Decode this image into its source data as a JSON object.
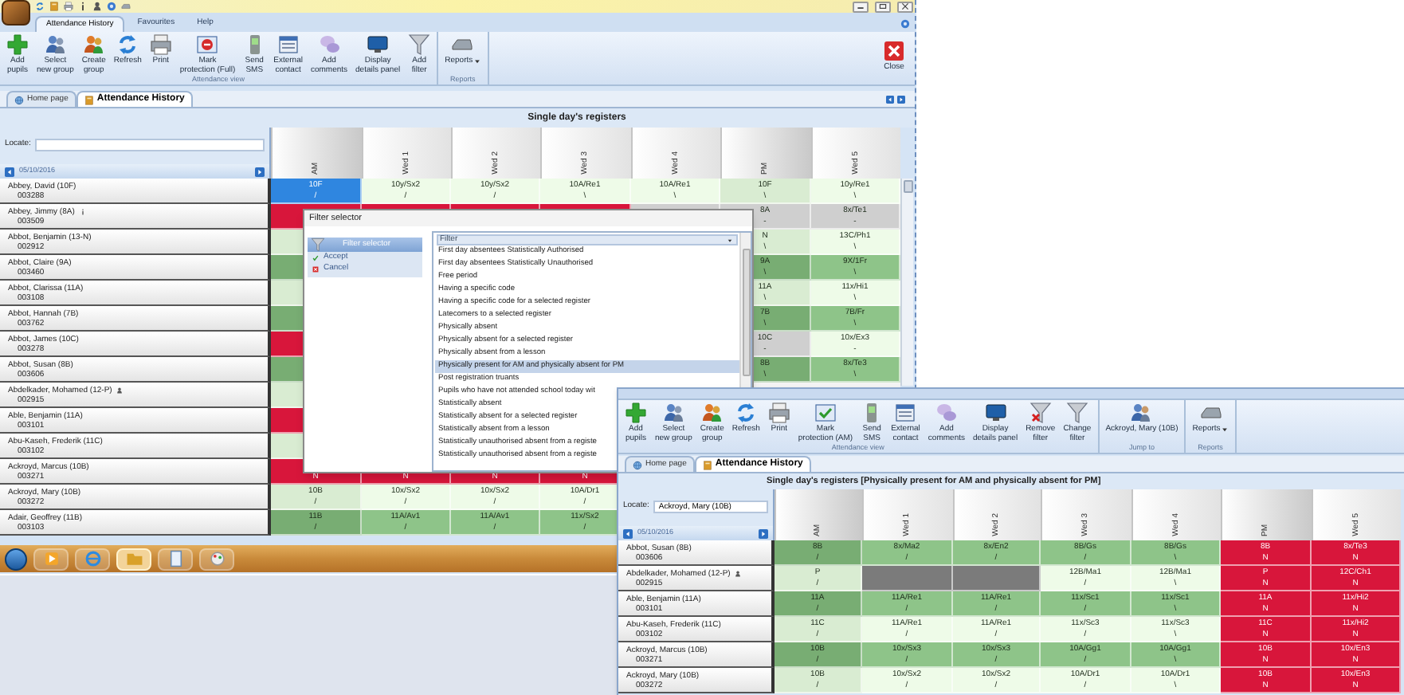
{
  "main_window": {
    "ribbon_tabs": [
      {
        "label": "Attendance History",
        "selected": true
      },
      {
        "label": "Favourites",
        "selected": false
      },
      {
        "label": "Help",
        "selected": false
      }
    ],
    "ribbon_groups": [
      {
        "label": "Attendance view",
        "buttons": [
          {
            "label": "Add\npupils",
            "kind": "add"
          },
          {
            "label": "Select\nnew group",
            "kind": "group"
          },
          {
            "label": "Create\ngroup",
            "kind": "create"
          },
          {
            "label": "Refresh",
            "kind": "refresh"
          },
          {
            "label": "Print",
            "kind": "print"
          },
          {
            "label": "Mark\nprotection (Full)",
            "kind": "protect"
          },
          {
            "label": "Send\nSMS",
            "kind": "sms"
          },
          {
            "label": "External\ncontact",
            "kind": "contact"
          },
          {
            "label": "Add\ncomments",
            "kind": "comment"
          },
          {
            "label": "Display\ndetails panel",
            "kind": "panel"
          },
          {
            "label": "Add\nfilter",
            "kind": "filter"
          }
        ]
      },
      {
        "label": "Reports",
        "buttons": [
          {
            "label": "Reports",
            "kind": "reports"
          }
        ]
      }
    ],
    "close_button": {
      "label": "Close",
      "kind": "close"
    },
    "doc_tabs": [
      {
        "label": "Home page",
        "selected": false
      },
      {
        "label": "Attendance History",
        "selected": true
      }
    ],
    "title": "Single day's registers",
    "locate_label": "Locate:",
    "date": "05/10/2016",
    "columns": [
      "AM",
      "Wed 1",
      "Wed 2",
      "Wed 3",
      "Wed 4",
      "PM",
      "Wed 5"
    ],
    "rows": [
      {
        "name": "Abbey, David (10F)",
        "id": "003288",
        "kind": "plain",
        "cells": [
          {
            "code": "10F",
            "mark": "/",
            "color": "#2f86e0"
          },
          {
            "code": "10y/Sx2",
            "mark": "/",
            "color": "#eefbe8"
          },
          {
            "code": "10y/Sx2",
            "mark": "/",
            "color": "#eefbe8"
          },
          {
            "code": "10A/Re1",
            "mark": "\\",
            "color": "#eefbe8"
          },
          {
            "code": "10A/Re1",
            "mark": "\\",
            "color": "#eefbe8"
          },
          {
            "code": "10F",
            "mark": "\\",
            "color": "#d9ecd2"
          },
          {
            "code": "10y/Re1",
            "mark": "\\",
            "color": "#eefbe8"
          }
        ]
      },
      {
        "name": "Abbey, Jimmy (8A)",
        "id": "003509",
        "kind": "info",
        "cells": [
          {
            "color": "#d8163b"
          },
          {
            "color": "#d8163b"
          },
          {
            "color": "#d8163b"
          },
          {
            "color": "#d8163b"
          },
          {
            "color": "#cfcfcf"
          },
          {
            "code": "8A",
            "mark": "-",
            "color": "#cfcfcf"
          },
          {
            "code": "8x/Te1",
            "mark": "-",
            "color": "#cfcfcf"
          }
        ]
      },
      {
        "name": "Abbot, Benjamin (13-N)",
        "id": "002912",
        "kind": "plain",
        "cells": [
          {
            "color": "#d9ecd2"
          },
          null,
          null,
          null,
          null,
          {
            "code": "N",
            "mark": "\\",
            "color": "#d9ecd2"
          },
          {
            "code": "13C/Ph1",
            "mark": "\\",
            "color": "#eefbe8"
          }
        ]
      },
      {
        "name": "Abbot, Claire (9A)",
        "id": "003460",
        "kind": "plain",
        "cells": [
          {
            "color": "#78ad73"
          },
          null,
          null,
          null,
          null,
          {
            "code": "9A",
            "mark": "\\",
            "color": "#78ad73"
          },
          {
            "code": "9X/1Fr",
            "mark": "\\",
            "color": "#8ec489"
          }
        ]
      },
      {
        "name": "Abbot, Clarissa (11A)",
        "id": "003108",
        "kind": "plain",
        "cells": [
          {
            "color": "#d9ecd2"
          },
          null,
          null,
          null,
          null,
          {
            "code": "11A",
            "mark": "\\",
            "color": "#d9ecd2"
          },
          {
            "code": "11x/Hi1",
            "mark": "\\",
            "color": "#eefbe8"
          }
        ]
      },
      {
        "name": "Abbot, Hannah (7B)",
        "id": "003762",
        "kind": "plain",
        "cells": [
          {
            "color": "#78ad73"
          },
          null,
          null,
          null,
          null,
          {
            "code": "7B",
            "mark": "\\",
            "color": "#78ad73"
          },
          {
            "code": "7B/Fr",
            "mark": "\\",
            "color": "#8ec489"
          }
        ]
      },
      {
        "name": "Abbot, James (10C)",
        "id": "003278",
        "kind": "plain",
        "cells": [
          {
            "color": "#d8163b"
          },
          null,
          null,
          null,
          null,
          {
            "code": "10C",
            "mark": "-",
            "color": "#cfcfcf"
          },
          {
            "code": "10x/Ex3",
            "mark": "-",
            "color": "#eefbe8"
          }
        ]
      },
      {
        "name": "Abbot, Susan (8B)",
        "id": "003606",
        "kind": "plain",
        "cells": [
          {
            "color": "#78ad73"
          },
          null,
          null,
          null,
          null,
          {
            "code": "8B",
            "mark": "\\",
            "color": "#78ad73"
          },
          {
            "code": "8x/Te3",
            "mark": "\\",
            "color": "#8ec489"
          }
        ]
      },
      {
        "name": "Abdelkader, Mohamed (12-P)",
        "id": "002915",
        "kind": "pupil",
        "cells": [
          {
            "color": "#d9ecd2"
          },
          null,
          null,
          null,
          null,
          null,
          null
        ]
      },
      {
        "name": "Able, Benjamin (11A)",
        "id": "003101",
        "kind": "plain",
        "cells": [
          {
            "color": "#d8163b"
          },
          null,
          null,
          null,
          null,
          null,
          null
        ]
      },
      {
        "name": "Abu-Kaseh, Frederik (11C)",
        "id": "003102",
        "kind": "plain",
        "cells": [
          {
            "color": "#d9ecd2"
          },
          null,
          null,
          null,
          null,
          null,
          null
        ]
      },
      {
        "name": "Ackroyd, Marcus (10B)",
        "id": "003271",
        "kind": "plain",
        "cells": [
          {
            "mark": "N",
            "color": "#d8163b"
          },
          {
            "mark": "N",
            "color": "#d8163b"
          },
          {
            "mark": "N",
            "color": "#d8163b"
          },
          {
            "mark": "N",
            "color": "#d8163b"
          },
          null,
          null,
          null
        ]
      },
      {
        "name": "Ackroyd, Mary (10B)",
        "id": "003272",
        "kind": "plain",
        "cells": [
          {
            "code": "10B",
            "mark": "/",
            "color": "#d9ecd2"
          },
          {
            "code": "10x/Sx2",
            "mark": "/",
            "color": "#eefbe8"
          },
          {
            "code": "10x/Sx2",
            "mark": "/",
            "color": "#eefbe8"
          },
          {
            "code": "10A/Dr1",
            "mark": "/",
            "color": "#eefbe8"
          },
          null,
          null,
          null
        ]
      },
      {
        "name": "Adair, Geoffrey (11B)",
        "id": "003103",
        "kind": "plain",
        "cells": [
          {
            "code": "11B",
            "mark": "/",
            "color": "#78ad73"
          },
          {
            "code": "11A/Av1",
            "mark": "/",
            "color": "#8ec489"
          },
          {
            "code": "11A/Av1",
            "mark": "/",
            "color": "#8ec489"
          },
          {
            "code": "11x/Sx2",
            "mark": "/",
            "color": "#8ec489"
          },
          null,
          null,
          null
        ]
      }
    ]
  },
  "filter_dialog": {
    "title": "Filter selector",
    "actions": [
      {
        "label": "Filter selector",
        "kind": "header"
      },
      {
        "label": "Accept",
        "kind": "accept"
      },
      {
        "label": "Cancel",
        "kind": "cancel"
      }
    ],
    "list_header": "Filter",
    "items": [
      {
        "label": "First day absentees Statistically Authorised",
        "selected": false
      },
      {
        "label": "First day absentees Statistically Unauthorised",
        "selected": false
      },
      {
        "label": "Free period",
        "selected": false
      },
      {
        "label": "Having a specific code",
        "selected": false
      },
      {
        "label": "Having a specific code for a selected register",
        "selected": false
      },
      {
        "label": "Latecomers to a selected register",
        "selected": false
      },
      {
        "label": "Physically absent",
        "selected": false
      },
      {
        "label": "Physically absent for a selected register",
        "selected": false
      },
      {
        "label": "Physically absent from a lesson",
        "selected": false
      },
      {
        "label": "Physically present for AM and physically absent for PM",
        "selected": true
      },
      {
        "label": "Post registration truants",
        "selected": false
      },
      {
        "label": "Pupils who have not attended school today wit",
        "selected": false
      },
      {
        "label": "Statistically absent",
        "selected": false
      },
      {
        "label": "Statistically absent for a selected register",
        "selected": false
      },
      {
        "label": "Statistically absent from a lesson",
        "selected": false
      },
      {
        "label": "Statistically unauthorised absent from a registe",
        "selected": false
      },
      {
        "label": "Statistically unauthorised absent from a registe",
        "selected": false
      }
    ]
  },
  "second_window": {
    "ribbon_groups": [
      {
        "label": "Attendance view",
        "buttons": [
          {
            "label": "Add\npupils",
            "kind": "add"
          },
          {
            "label": "Select\nnew group",
            "kind": "group"
          },
          {
            "label": "Create\ngroup",
            "kind": "create"
          },
          {
            "label": "Refresh",
            "kind": "refresh"
          },
          {
            "label": "Print",
            "kind": "print"
          },
          {
            "label": "Mark\nprotection (AM)",
            "kind": "protect-check"
          },
          {
            "label": "Send\nSMS",
            "kind": "sms"
          },
          {
            "label": "External\ncontact",
            "kind": "contact"
          },
          {
            "label": "Add\ncomments",
            "kind": "comment"
          },
          {
            "label": "Display\ndetails panel",
            "kind": "panel"
          },
          {
            "label": "Remove\nfilter",
            "kind": "filter-remove"
          },
          {
            "label": "Change\nfilter",
            "kind": "filter"
          }
        ]
      },
      {
        "label": "Jump to",
        "buttons": [
          {
            "label": "Ackroyd, Mary (10B)",
            "kind": "pupil"
          }
        ]
      },
      {
        "label": "Reports",
        "buttons": [
          {
            "label": "Reports",
            "kind": "reports"
          }
        ]
      }
    ],
    "doc_tabs": [
      {
        "label": "Home page",
        "selected": false
      },
      {
        "label": "Attendance History",
        "selected": true
      }
    ],
    "title": "Single day's registers [Physically present for AM and physically absent for PM]",
    "locate_label": "Locate:",
    "locate_value": "Ackroyd, Mary (10B)",
    "date": "05/10/2016",
    "columns": [
      "AM",
      "Wed 1",
      "Wed 2",
      "Wed 3",
      "Wed 4",
      "PM",
      "Wed 5"
    ],
    "rows": [
      {
        "name": "Abbot, Susan (8B)",
        "id": "003606",
        "kind": "plain",
        "cells": [
          {
            "code": "8B",
            "mark": "/",
            "color": "#78ad73"
          },
          {
            "code": "8x/Ma2",
            "mark": "/",
            "color": "#8ec489"
          },
          {
            "code": "8x/En2",
            "mark": "/",
            "color": "#8ec489"
          },
          {
            "code": "8B/Gs",
            "mark": "/",
            "color": "#8ec489"
          },
          {
            "code": "8B/Gs",
            "mark": "\\",
            "color": "#8ec489"
          },
          {
            "code": "8B",
            "mark": "N",
            "color": "#d8163b"
          },
          {
            "code": "8x/Te3",
            "mark": "N",
            "color": "#d8163b"
          }
        ]
      },
      {
        "name": "Abdelkader, Mohamed (12-P)",
        "id": "002915",
        "kind": "pupil",
        "cells": [
          {
            "code": "P",
            "mark": "/",
            "color": "#d9ecd2"
          },
          {
            "color": "#7b7b7b"
          },
          {
            "color": "#7b7b7b"
          },
          {
            "code": "12B/Ma1",
            "mark": "/",
            "color": "#eefbe8"
          },
          {
            "code": "12B/Ma1",
            "mark": "\\",
            "color": "#eefbe8"
          },
          {
            "code": "P",
            "mark": "N",
            "color": "#d8163b"
          },
          {
            "code": "12C/Ch1",
            "mark": "N",
            "color": "#d8163b"
          }
        ]
      },
      {
        "name": "Able, Benjamin (11A)",
        "id": "003101",
        "kind": "plain",
        "cells": [
          {
            "code": "11A",
            "mark": "/",
            "color": "#78ad73"
          },
          {
            "code": "11A/Re1",
            "mark": "/",
            "color": "#8ec489"
          },
          {
            "code": "11A/Re1",
            "mark": "/",
            "color": "#8ec489"
          },
          {
            "code": "11x/Sc1",
            "mark": "/",
            "color": "#8ec489"
          },
          {
            "code": "11x/Sc1",
            "mark": "\\",
            "color": "#8ec489"
          },
          {
            "code": "11A",
            "mark": "N",
            "color": "#d8163b"
          },
          {
            "code": "11x/Hi2",
            "mark": "N",
            "color": "#d8163b"
          }
        ]
      },
      {
        "name": "Abu-Kaseh, Frederik (11C)",
        "id": "003102",
        "kind": "plain",
        "cells": [
          {
            "code": "11C",
            "mark": "/",
            "color": "#d9ecd2"
          },
          {
            "code": "11A/Re1",
            "mark": "/",
            "color": "#eefbe8"
          },
          {
            "code": "11A/Re1",
            "mark": "/",
            "color": "#eefbe8"
          },
          {
            "code": "11x/Sc3",
            "mark": "/",
            "color": "#eefbe8"
          },
          {
            "code": "11x/Sc3",
            "mark": "\\",
            "color": "#eefbe8"
          },
          {
            "code": "11C",
            "mark": "N",
            "color": "#d8163b"
          },
          {
            "code": "11x/Hi2",
            "mark": "N",
            "color": "#d8163b"
          }
        ]
      },
      {
        "name": "Ackroyd, Marcus (10B)",
        "id": "003271",
        "kind": "plain",
        "cells": [
          {
            "code": "10B",
            "mark": "/",
            "color": "#78ad73"
          },
          {
            "code": "10x/Sx3",
            "mark": "/",
            "color": "#8ec489"
          },
          {
            "code": "10x/Sx3",
            "mark": "/",
            "color": "#8ec489"
          },
          {
            "code": "10A/Gg1",
            "mark": "/",
            "color": "#8ec489"
          },
          {
            "code": "10A/Gg1",
            "mark": "\\",
            "color": "#8ec489"
          },
          {
            "code": "10B",
            "mark": "N",
            "color": "#d8163b"
          },
          {
            "code": "10x/En3",
            "mark": "N",
            "color": "#d8163b"
          }
        ]
      },
      {
        "name": "Ackroyd, Mary (10B)",
        "id": "003272",
        "kind": "plain",
        "cells": [
          {
            "code": "10B",
            "mark": "/",
            "color": "#d9ecd2"
          },
          {
            "code": "10x/Sx2",
            "mark": "/",
            "color": "#eefbe8"
          },
          {
            "code": "10x/Sx2",
            "mark": "/",
            "color": "#eefbe8"
          },
          {
            "code": "10A/Dr1",
            "mark": "/",
            "color": "#eefbe8"
          },
          {
            "code": "10A/Dr1",
            "mark": "\\",
            "color": "#eefbe8"
          },
          {
            "code": "10B",
            "mark": "N",
            "color": "#d8163b"
          },
          {
            "code": "10x/En3",
            "mark": "N",
            "color": "#d8163b"
          }
        ]
      }
    ]
  }
}
